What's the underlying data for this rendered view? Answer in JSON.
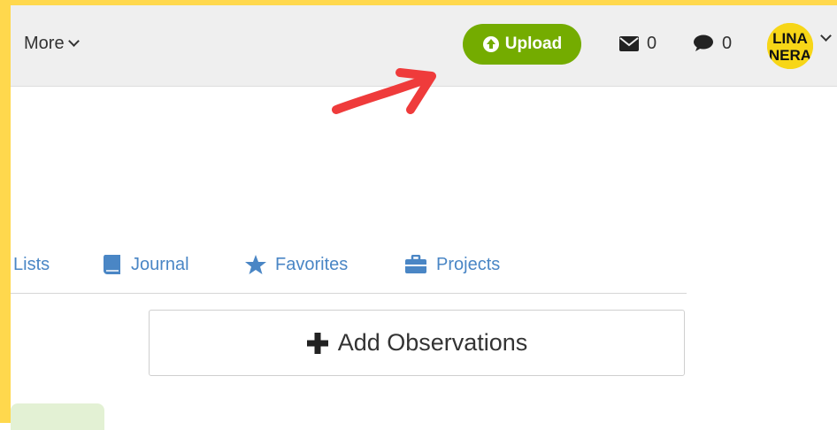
{
  "topbar": {
    "more_label": "More",
    "upload_label": "Upload",
    "messages_count": "0",
    "comments_count": "0",
    "avatar_text": "LINA NERA"
  },
  "tabs": [
    {
      "label": "Lists",
      "icon": "list-icon"
    },
    {
      "label": "Journal",
      "icon": "book-icon"
    },
    {
      "label": "Favorites",
      "icon": "star-icon"
    },
    {
      "label": "Projects",
      "icon": "briefcase-icon"
    }
  ],
  "main": {
    "add_observations_label": "Add Observations"
  },
  "colors": {
    "frame": "#ffd84d",
    "upload_green": "#74ac00",
    "link_blue": "#4a86c5",
    "arrow_red": "#ef3b3b"
  }
}
